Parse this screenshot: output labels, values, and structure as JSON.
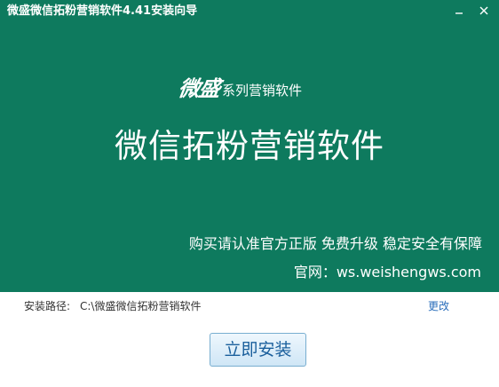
{
  "window": {
    "title": "微盛微信拓粉营销软件4.41安装向导",
    "controls": {
      "minimize_icon": "minimize-icon",
      "close_icon": "close-icon"
    }
  },
  "banner": {
    "logo_script": "微盛",
    "logo_subtitle": "系列营销软件",
    "product_name": "微信拓粉营销软件",
    "slogan": "购买请认准官方正版 免费升级 稳定安全有保障",
    "website": "官网：ws.weishengws.com"
  },
  "install": {
    "path_label": "安装路径:",
    "path_value": "C:\\微盛微信拓粉营销软件",
    "change_label": "更改",
    "install_button_label": "立即安装"
  },
  "colors": {
    "banner_bg": "#0e7a5e",
    "link": "#2a6ebb",
    "button_text": "#1a5f9c"
  }
}
